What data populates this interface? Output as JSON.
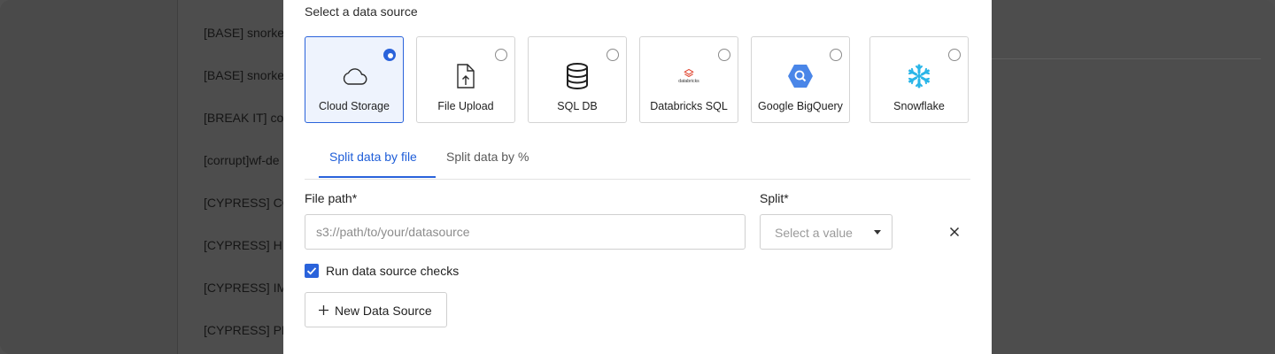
{
  "background": {
    "list_items": [
      "[BASE] snorkel",
      "[BASE] snorkel",
      "[BREAK IT] co",
      "[corrupt]wf-de",
      "[CYPRESS] CO",
      "[CYPRESS] HI",
      "[CYPRESS] IM",
      "[CYPRESS] PD"
    ]
  },
  "modal": {
    "section_label": "Select a data source",
    "sources": [
      {
        "label": "Cloud Storage",
        "icon": "cloud-icon",
        "selected": true
      },
      {
        "label": "File Upload",
        "icon": "file-upload-icon",
        "selected": false
      },
      {
        "label": "SQL DB",
        "icon": "database-icon",
        "selected": false
      },
      {
        "label": "Databricks SQL",
        "icon": "databricks-logo",
        "logo_text": "databricks",
        "selected": false
      },
      {
        "label": "Google BigQuery",
        "icon": "bigquery-logo",
        "selected": false
      },
      {
        "label": "Snowflake",
        "icon": "snowflake-logo",
        "selected": false
      }
    ],
    "tabs": [
      {
        "label": "Split data by file",
        "active": true
      },
      {
        "label": "Split data by %",
        "active": false
      }
    ],
    "file_path": {
      "label": "File path*",
      "placeholder": "s3://path/to/your/datasource",
      "value": ""
    },
    "split": {
      "label": "Split*",
      "placeholder": "Select a value"
    },
    "run_checks": {
      "label": "Run data source checks",
      "checked": true
    },
    "new_source_button": "New Data Source"
  },
  "colors": {
    "accent": "#2a63db",
    "overlay": "#4d4d4d",
    "bigquery": "#4a86e8",
    "snowflake": "#29b5e8",
    "databricks": "#e0442f"
  }
}
